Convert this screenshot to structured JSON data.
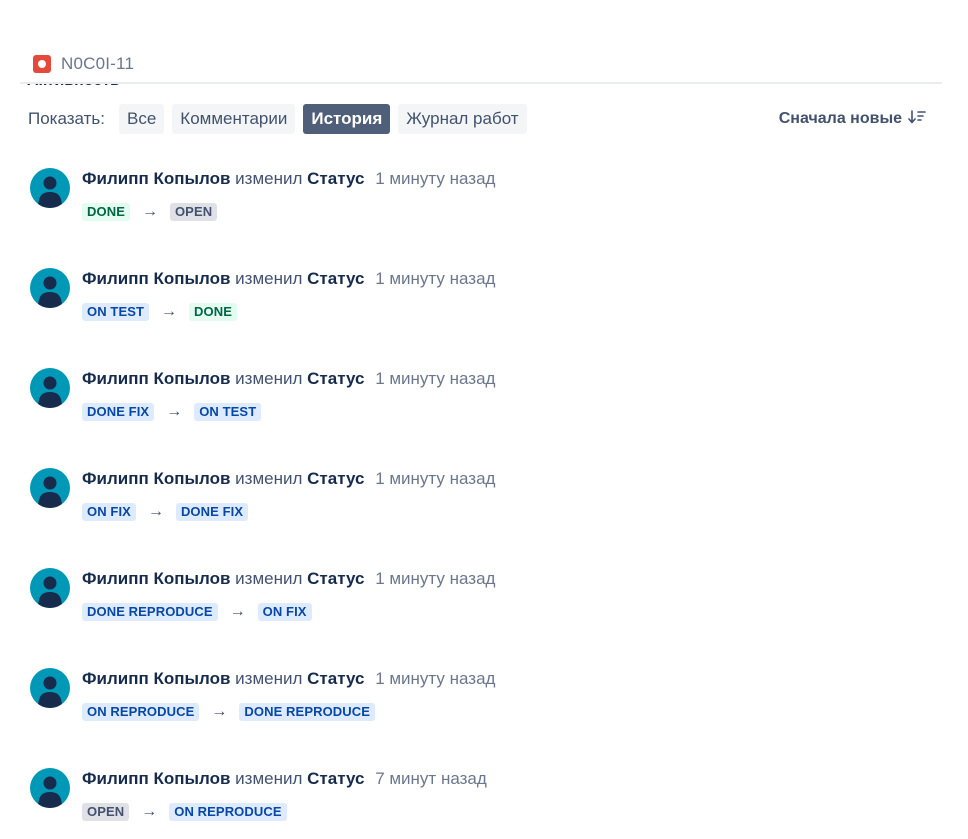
{
  "issue": {
    "key": "N0C0I-11",
    "type_icon": "bug-icon",
    "type_color": "#e5493a"
  },
  "activity": {
    "title": "Активность",
    "show_label": "Показать:",
    "filters": [
      {
        "label": "Все",
        "active": false
      },
      {
        "label": "Комментарии",
        "active": false
      },
      {
        "label": "История",
        "active": true
      },
      {
        "label": "Журнал работ",
        "active": false
      }
    ],
    "sort_label": "Сначала новые",
    "sort_icon": "sort-descending-icon"
  },
  "colors": {
    "avatar_bg": "#0098b7",
    "active_filter": "#505f79",
    "lozenge_done": "#e3fcef",
    "lozenge_progress": "#deebff",
    "lozenge_todo": "#dfe1e6"
  },
  "history": [
    {
      "user": "Филипп Копылов",
      "action": "изменил",
      "field": "Статус",
      "time": "1 минуту назад",
      "from": {
        "label": "DONE",
        "tone": "green"
      },
      "arrow": "→",
      "to": {
        "label": "OPEN",
        "tone": "gray"
      }
    },
    {
      "user": "Филипп Копылов",
      "action": "изменил",
      "field": "Статус",
      "time": "1 минуту назад",
      "from": {
        "label": "ON TEST",
        "tone": "blue"
      },
      "arrow": "→",
      "to": {
        "label": "DONE",
        "tone": "green"
      }
    },
    {
      "user": "Филипп Копылов",
      "action": "изменил",
      "field": "Статус",
      "time": "1 минуту назад",
      "from": {
        "label": "DONE FIX",
        "tone": "blue"
      },
      "arrow": "→",
      "to": {
        "label": "ON TEST",
        "tone": "blue"
      }
    },
    {
      "user": "Филипп Копылов",
      "action": "изменил",
      "field": "Статус",
      "time": "1 минуту назад",
      "from": {
        "label": "ON FIX",
        "tone": "blue"
      },
      "arrow": "→",
      "to": {
        "label": "DONE FIX",
        "tone": "blue"
      }
    },
    {
      "user": "Филипп Копылов",
      "action": "изменил",
      "field": "Статус",
      "time": "1 минуту назад",
      "from": {
        "label": "DONE REPRODUCE",
        "tone": "blue"
      },
      "arrow": "→",
      "to": {
        "label": "ON FIX",
        "tone": "blue"
      }
    },
    {
      "user": "Филипп Копылов",
      "action": "изменил",
      "field": "Статус",
      "time": "1 минуту назад",
      "from": {
        "label": "ON REPRODUCE",
        "tone": "blue"
      },
      "arrow": "→",
      "to": {
        "label": "DONE REPRODUCE",
        "tone": "blue"
      }
    },
    {
      "user": "Филипп Копылов",
      "action": "изменил",
      "field": "Статус",
      "time": "7 минут назад",
      "from": {
        "label": "OPEN",
        "tone": "gray"
      },
      "arrow": "→",
      "to": {
        "label": "ON REPRODUCE",
        "tone": "blue"
      }
    }
  ]
}
